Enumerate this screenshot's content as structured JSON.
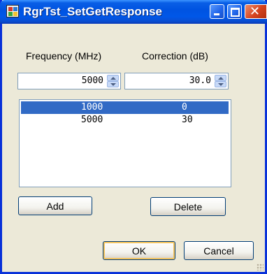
{
  "window": {
    "title": "RgrTst_SetGetResponse"
  },
  "labels": {
    "frequency": "Frequency (MHz)",
    "correction": "Correction (dB)"
  },
  "inputs": {
    "frequency_value": "5000",
    "correction_value": "30.0"
  },
  "table": {
    "rows": [
      {
        "frequency": "1000",
        "correction": "0",
        "selected": true
      },
      {
        "frequency": "5000",
        "correction": "30",
        "selected": false
      }
    ]
  },
  "buttons": {
    "add": "Add",
    "delete": "Delete",
    "ok": "OK",
    "cancel": "Cancel"
  },
  "colors": {
    "selection": "#316ac5",
    "titlebar": "#0053e1",
    "dialog_bg": "#ece9d8"
  }
}
